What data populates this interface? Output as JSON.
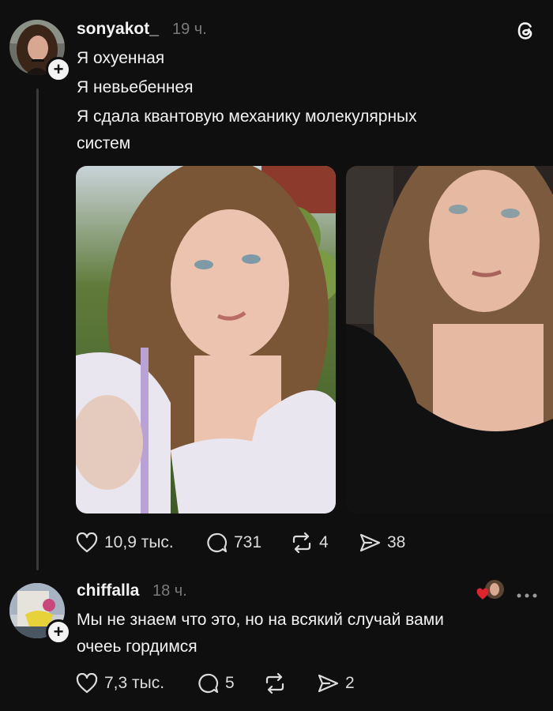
{
  "post": {
    "username": "sonyakot_",
    "time": "19 ч.",
    "lines": [
      "Я охуенная",
      "Я невьебеннея",
      "Я сдала квантовую механику молекулярных",
      "систем"
    ],
    "likes": "10,9 тыс.",
    "comments": "731",
    "reposts": "4",
    "shares": "38"
  },
  "reply": {
    "username": "chiffalla",
    "time": "18 ч.",
    "lines": [
      "Мы не знаем что это, но на всякий случай вами",
      "очеeь гордимся"
    ],
    "likes": "7,3 тыс.",
    "comments": "5",
    "shares": "2"
  },
  "icons": {
    "threads": "threads-logo-icon",
    "like": "heart-icon",
    "comment": "comment-bubble-icon",
    "repost": "repost-icon",
    "share": "share-arrow-icon",
    "more": "more-dots-icon",
    "liked_by_author": "red-heart-icon"
  },
  "colors": {
    "background": "#0f0f0f",
    "text": "#f3f3f3",
    "muted": "#7a7a7a",
    "red_heart": "#e0242e"
  }
}
